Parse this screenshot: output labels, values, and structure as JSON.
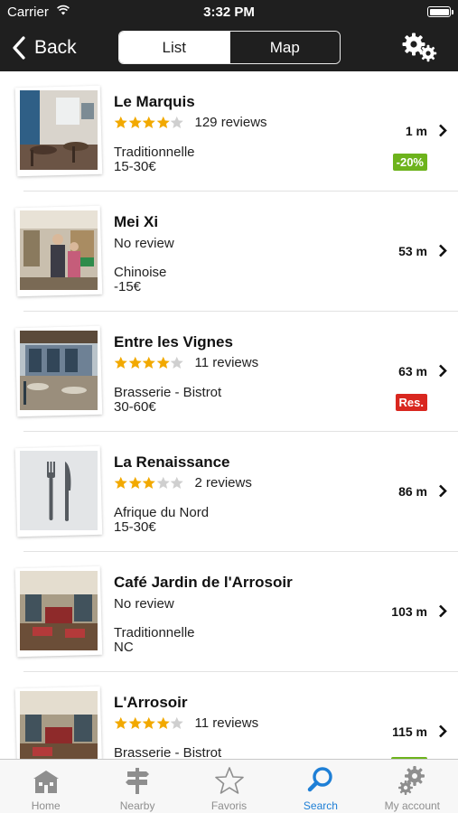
{
  "status_bar": {
    "carrier": "Carrier",
    "time": "3:32 PM"
  },
  "nav": {
    "back_label": "Back",
    "segments": [
      {
        "label": "List",
        "active": true
      },
      {
        "label": "Map",
        "active": false
      }
    ],
    "settings_icon": "gears-icon"
  },
  "restaurants": [
    {
      "name": "Le Marquis",
      "rating": 4,
      "reviews": "129 reviews",
      "cuisine": "Traditionnelle",
      "price": "15-30€",
      "distance": "1 m",
      "badge": "-20%",
      "badge_color": "#6db31c"
    },
    {
      "name": "Mei Xi",
      "rating": null,
      "reviews": "No review",
      "cuisine": "Chinoise",
      "price": "-15€",
      "distance": "53 m",
      "badge": null,
      "badge_color": null
    },
    {
      "name": "Entre les Vignes",
      "rating": 4,
      "reviews": "11 reviews",
      "cuisine": "Brasserie - Bistrot",
      "price": "30-60€",
      "distance": "63 m",
      "badge": "Res.",
      "badge_color": "#d9271f"
    },
    {
      "name": "La Renaissance",
      "rating": 3,
      "reviews": "2 reviews",
      "cuisine": "Afrique du Nord",
      "price": "15-30€",
      "distance": "86 m",
      "badge": null,
      "badge_color": null
    },
    {
      "name": "Café Jardin de l'Arrosoir",
      "rating": null,
      "reviews": "No review",
      "cuisine": "Traditionnelle",
      "price": "NC",
      "distance": "103 m",
      "badge": null,
      "badge_color": null
    },
    {
      "name": "L'Arrosoir",
      "rating": 4,
      "reviews": "11 reviews",
      "cuisine": "Brasserie - Bistrot",
      "price": "",
      "distance": "115 m",
      "badge": "",
      "badge_color": "#6db31c"
    }
  ],
  "tabs": [
    {
      "label": "Home",
      "icon": "home-icon",
      "active": false
    },
    {
      "label": "Nearby",
      "icon": "signpost-icon",
      "active": false
    },
    {
      "label": "Favoris",
      "icon": "star-icon",
      "active": false
    },
    {
      "label": "Search",
      "icon": "search-icon",
      "active": true
    },
    {
      "label": "My account",
      "icon": "gear-icon",
      "active": false
    }
  ],
  "colors": {
    "bar_bg": "#1f1f1f",
    "star_on": "#f2a900",
    "star_off": "#cfcfcf",
    "tab_active": "#1e7fd6",
    "tab_inactive": "#8e8e8e"
  }
}
